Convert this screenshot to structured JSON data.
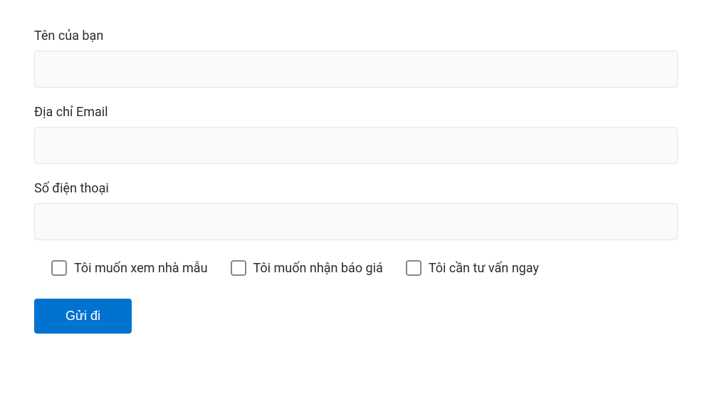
{
  "form": {
    "name": {
      "label": "Tên của bạn",
      "value": ""
    },
    "email": {
      "label": "Địa chỉ Email",
      "value": ""
    },
    "phone": {
      "label": "Số điện thoại",
      "value": ""
    },
    "checkboxes": [
      {
        "label": "Tôi muốn xem nhà mẫu",
        "checked": false
      },
      {
        "label": "Tôi muốn nhận báo giá",
        "checked": false
      },
      {
        "label": "Tôi cần tư vấn ngay",
        "checked": false
      }
    ],
    "submit_label": "Gửi đi"
  }
}
